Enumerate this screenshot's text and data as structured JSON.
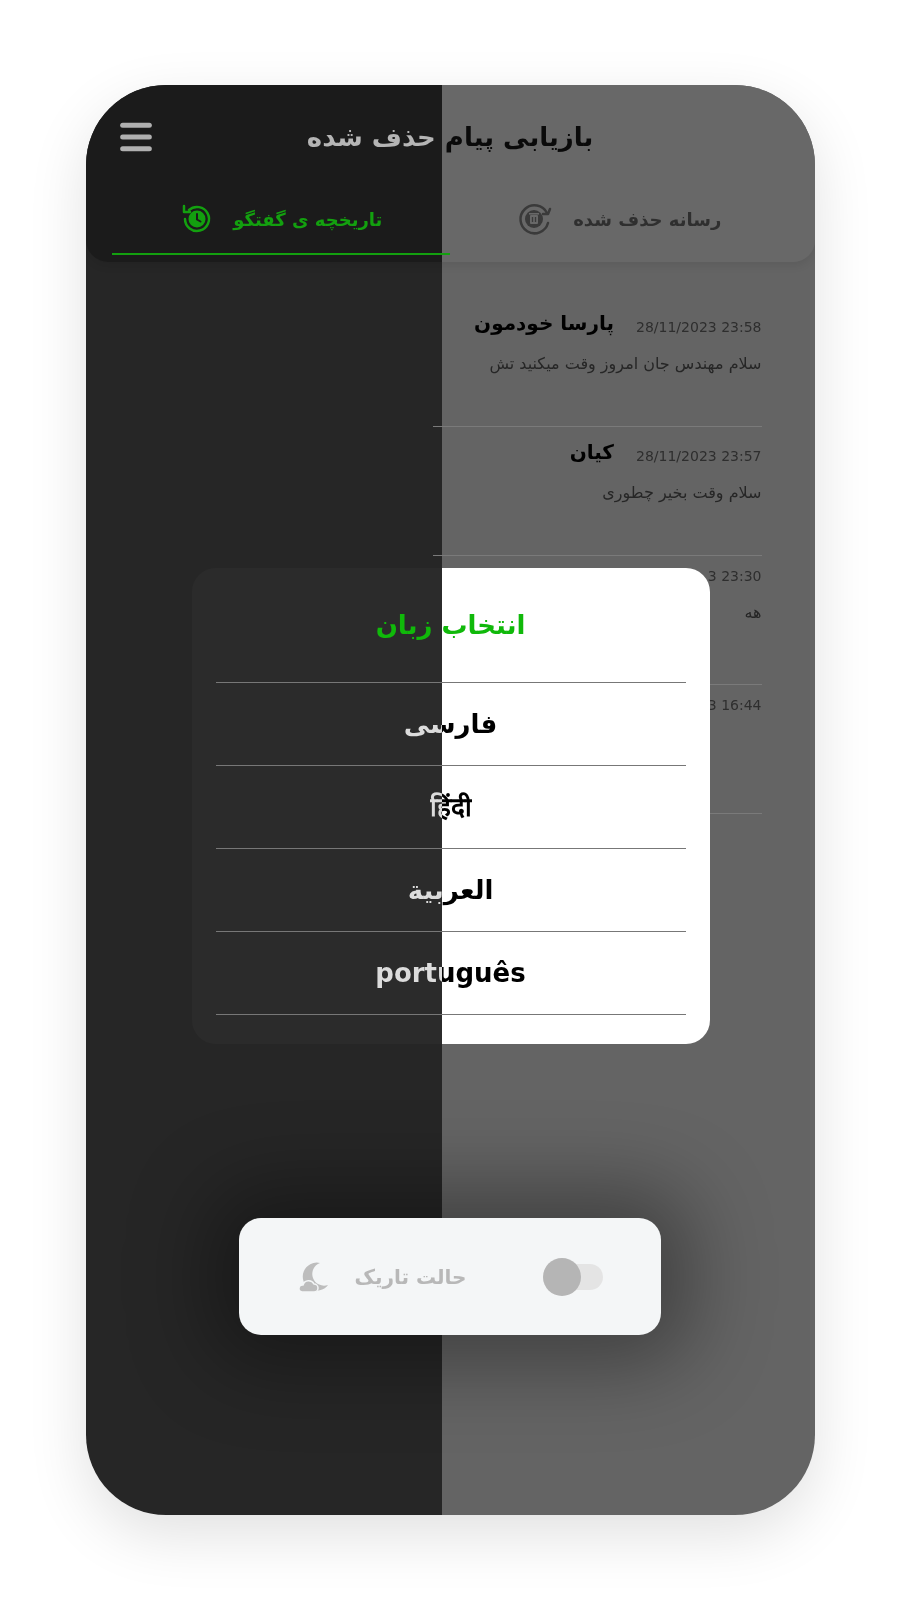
{
  "header": {
    "title": "بازیابی پیام حذف شده"
  },
  "tabs": [
    {
      "label": "رسانه حذف شده",
      "kind": "media",
      "selected": false
    },
    {
      "label": "تاریخچه ی گفتگو",
      "kind": "history",
      "selected": true
    }
  ],
  "messages": [
    {
      "time": "28/11/2023 23:58",
      "name": "پارسا خودمون",
      "text": "سلام مهندس جان امروز وقت میکنید تش"
    },
    {
      "time": "28/11/2023 23:57",
      "name": "کیان",
      "text": "سلام وقت بخیر چطوری"
    },
    {
      "time": "3 23:30",
      "text": "هه"
    },
    {
      "time": "3 16:44"
    }
  ],
  "language_dialog": {
    "title": "انتخاب زبان",
    "options": [
      "فارسی",
      "हिंदी",
      "العربية",
      "português"
    ]
  },
  "dark_mode": {
    "label": "حالت تاریک",
    "on": false
  }
}
